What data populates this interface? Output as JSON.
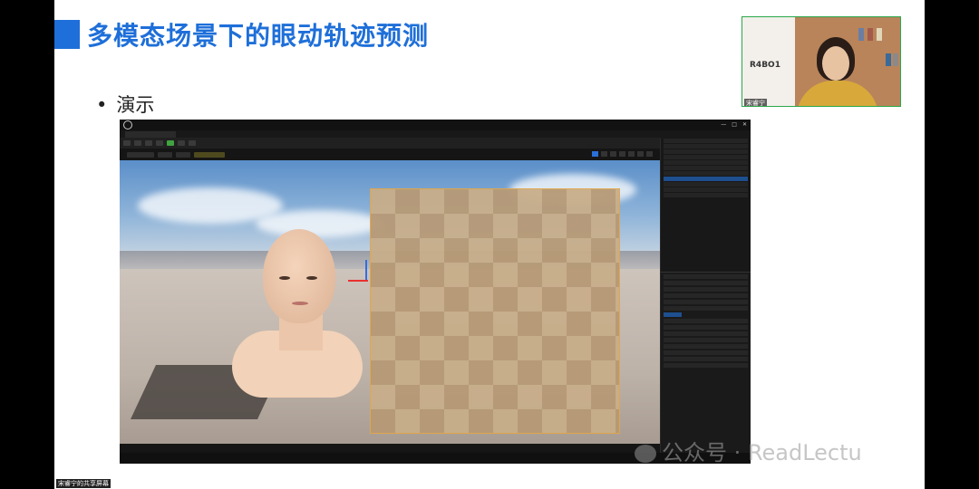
{
  "slide": {
    "title": "多模态场景下的眼动轨迹预测",
    "bullet": "演示"
  },
  "editor": {
    "window_controls": [
      "—",
      "□",
      "✕"
    ]
  },
  "webcam": {
    "name": "宋睿宁",
    "poster_text": "R4BO1"
  },
  "watermark": "公众号 · ReadLectu",
  "share_label": "宋睿宁的共享屏幕",
  "colors": {
    "accent": "#1e6fd9",
    "webcam_border": "#2aa84a"
  }
}
